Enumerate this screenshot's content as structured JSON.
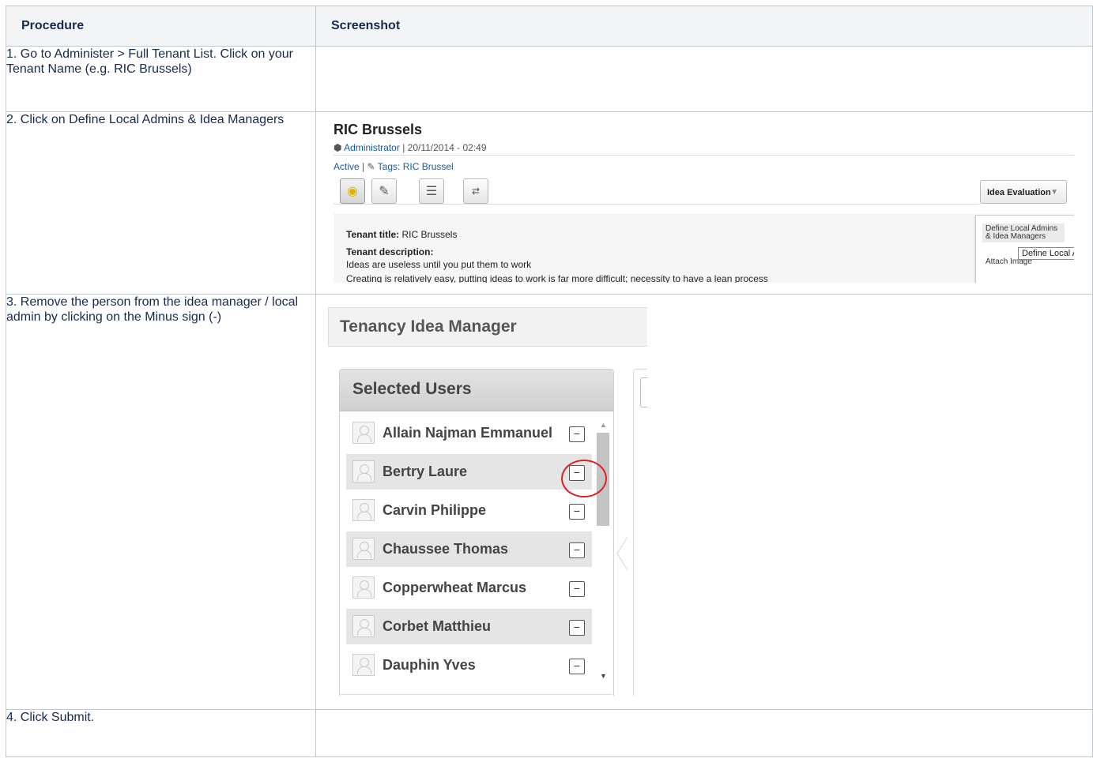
{
  "table": {
    "headers": [
      "Procedure",
      "Screenshot"
    ],
    "steps": [
      "1. Go to Administer > Full Tenant List. Click on your Tenant Name (e.g. RIC Brussels)",
      "2. Click on Define Local Admins & Idea Managers",
      "3. Remove the person from the idea manager / local admin by clicking on the Minus sign (-)",
      "4. Click Submit."
    ]
  },
  "tenant_shot": {
    "title": "RIC Brussels",
    "author": "Administrator",
    "date": "20/11/2014 - 02:49",
    "status": "Active",
    "tags": "Tags: RIC Brussel",
    "dropdown_label": "Idea Evaluation",
    "tenant_title_label": "Tenant title:",
    "tenant_title_value": "RIC Brussels",
    "tenant_description_label": "Tenant description:",
    "description_line1": "Ideas are useless until you put them to work",
    "description_line2": "Creating is relatively easy, putting ideas to work is far more difficult; necessity to have a lean process",
    "menu_item_1": "Define Local Admins & Idea Managers",
    "menu_item_2": "Attach Image",
    "tooltip": "Define Local Adm",
    "icons": [
      "eye-icon",
      "edit-icon",
      "list-icon",
      "translate-icon"
    ]
  },
  "manager_shot": {
    "header": "Tenancy Idea Manager",
    "panel_title": "Selected Users",
    "users": [
      "Allain Najman Emmanuel",
      "Bertry Laure",
      "Carvin Philippe",
      "Chaussee Thomas",
      "Copperwheat Marcus",
      "Corbet Matthieu",
      "Dauphin Yves"
    ],
    "remove_symbol": "−",
    "highlight_color": "#e02020",
    "accent_color": "#f5b700"
  }
}
